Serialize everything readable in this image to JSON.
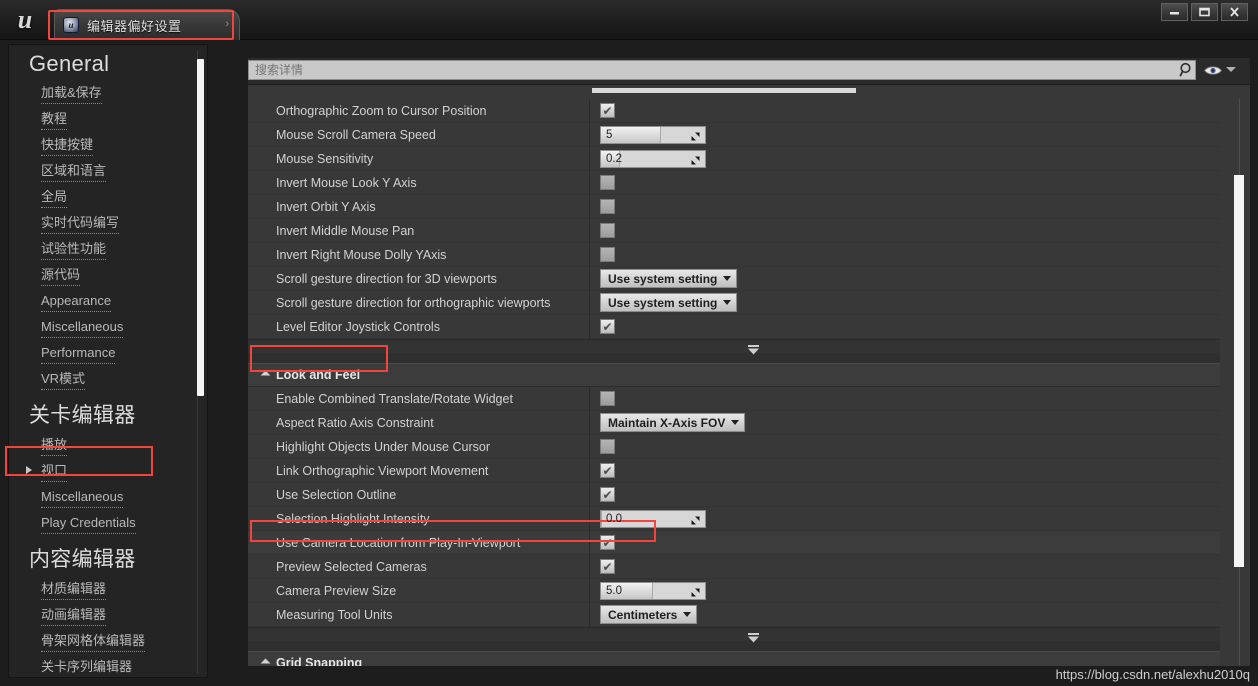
{
  "window": {
    "title_tab": "编辑器偏好设置",
    "tab_icon": "unreal-engine-icon",
    "logo": "u",
    "minimize_label": "—",
    "maximize_label": "□",
    "close_label": "✕"
  },
  "sidebar": {
    "groups": [
      {
        "title": "General",
        "items": [
          {
            "label": "加载&保存",
            "has_caret": false
          },
          {
            "label": "教程",
            "has_caret": false
          },
          {
            "label": "快捷按键",
            "has_caret": false
          },
          {
            "label": "区域和语言",
            "has_caret": false
          },
          {
            "label": "全局",
            "has_caret": false
          },
          {
            "label": "实时代码编写",
            "has_caret": false
          },
          {
            "label": "试验性功能",
            "has_caret": false
          },
          {
            "label": "源代码",
            "has_caret": false
          },
          {
            "label": "Appearance",
            "has_caret": false
          },
          {
            "label": "Miscellaneous",
            "has_caret": false
          },
          {
            "label": "Performance",
            "has_caret": false
          },
          {
            "label": "VR模式",
            "has_caret": false
          }
        ]
      },
      {
        "title": "关卡编辑器",
        "items": [
          {
            "label": "播放",
            "has_caret": false
          },
          {
            "label": "视口",
            "has_caret": true
          },
          {
            "label": "Miscellaneous",
            "has_caret": false
          },
          {
            "label": "Play Credentials",
            "has_caret": false
          }
        ]
      },
      {
        "title": "内容编辑器",
        "items": [
          {
            "label": "材质编辑器",
            "has_caret": false
          },
          {
            "label": "动画编辑器",
            "has_caret": false
          },
          {
            "label": "骨架网格体编辑器",
            "has_caret": false
          },
          {
            "label": "关卡序列编辑器",
            "has_caret": false
          }
        ]
      }
    ]
  },
  "search": {
    "placeholder": "搜索详情",
    "value": "",
    "search_icon": "magnifier-icon",
    "eye_icon": "eye-icon",
    "eye_caret_icon": "chevron-down-icon"
  },
  "details": {
    "sections": [
      {
        "rows": [
          {
            "label": "Orthographic Zoom to Cursor Position",
            "type": "checkbox",
            "checked": true
          },
          {
            "label": "Mouse Scroll Camera Speed",
            "type": "spinner",
            "value": "5",
            "fill_pct": 58
          },
          {
            "label": "Mouse Sensitivity",
            "type": "spinner",
            "value": "0.2",
            "fill_pct": 18
          },
          {
            "label": "Invert Mouse Look Y Axis",
            "type": "checkbox",
            "checked": false
          },
          {
            "label": "Invert Orbit Y Axis",
            "type": "checkbox",
            "checked": false
          },
          {
            "label": "Invert Middle Mouse Pan",
            "type": "checkbox",
            "checked": false
          },
          {
            "label": "Invert Right Mouse Dolly YAxis",
            "type": "checkbox",
            "checked": false
          },
          {
            "label": "Scroll gesture direction for 3D viewports",
            "type": "combo",
            "value": "Use system setting"
          },
          {
            "label": "Scroll gesture direction for orthographic viewports",
            "type": "combo",
            "value": "Use system setting"
          },
          {
            "label": "Level Editor Joystick Controls",
            "type": "checkbox",
            "checked": true
          }
        ]
      },
      {
        "header": "Look and Feel",
        "rows": [
          {
            "label": "Enable Combined Translate/Rotate Widget",
            "type": "checkbox",
            "checked": false
          },
          {
            "label": "Aspect Ratio Axis Constraint",
            "type": "combo",
            "value": "Maintain X-Axis FOV"
          },
          {
            "label": "Highlight Objects Under Mouse Cursor",
            "type": "checkbox",
            "checked": false
          },
          {
            "label": "Link Orthographic Viewport Movement",
            "type": "checkbox",
            "checked": true
          },
          {
            "label": "Use Selection Outline",
            "type": "checkbox",
            "checked": true
          },
          {
            "label": "Selection Highlight Intensity",
            "type": "spinner",
            "value": "0.0",
            "fill_pct": 0
          },
          {
            "label": "Use Camera Location from Play-In-Viewport",
            "type": "checkbox",
            "checked": true
          },
          {
            "label": "Preview Selected Cameras",
            "type": "checkbox",
            "checked": true
          },
          {
            "label": "Camera Preview Size",
            "type": "spinner",
            "value": "5.0",
            "fill_pct": 50
          },
          {
            "label": "Measuring Tool Units",
            "type": "combo",
            "value": "Centimeters"
          }
        ]
      },
      {
        "header": "Grid Snapping",
        "rows": []
      }
    ]
  },
  "highlights": {
    "accent_color": "#f2453d",
    "targets": [
      "编辑器偏好设置",
      "视口",
      "Look and Feel",
      "Use Camera Location from Play-In-Viewport"
    ]
  },
  "watermark": "https://blog.csdn.net/alexhu2010q"
}
